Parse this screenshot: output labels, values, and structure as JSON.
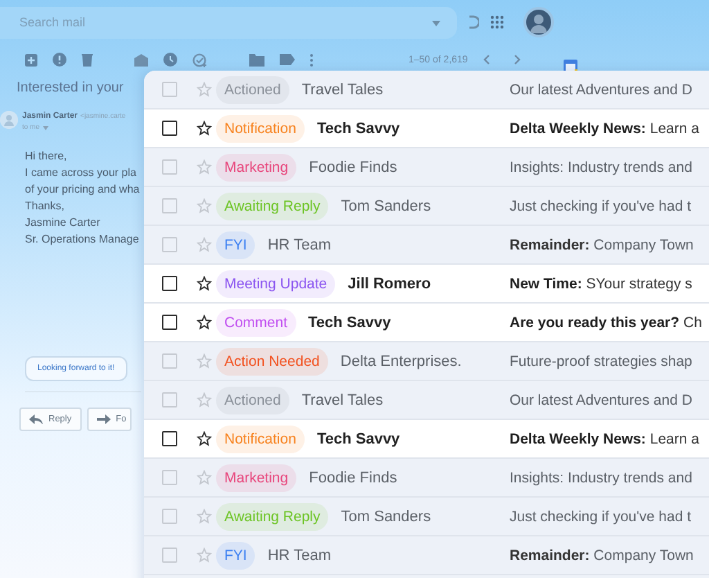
{
  "search": {
    "placeholder": "Search mail"
  },
  "toolbar": {
    "pagination": "1–50 of 2,619"
  },
  "message": {
    "subject": "Interested in your",
    "sender": "Jasmin Carter",
    "address": "<jasmine.carte",
    "recipient": "to me",
    "body": [
      "Hi there,",
      "I came across your pla",
      "of your pricing and wha",
      "Thanks,",
      "Jasmine Carter",
      "Sr. Operations Manage"
    ],
    "smart_reply": "Looking forward to it!",
    "actions": [
      "Reply",
      "Fo"
    ]
  },
  "inbox": {
    "rows": [
      {
        "label": "Actioned",
        "color": "#8a9099",
        "sender": "Travel Tales",
        "subject": "Our latest Adventures and D",
        "unread": false,
        "checked": false,
        "starred": false
      },
      {
        "label": "Notification",
        "color": "#f7821e",
        "sender": "Tech Savvy",
        "subject": "**Delta Weekly News:** Learn a",
        "unread": true,
        "checked": false,
        "starred": false
      },
      {
        "label": "Marketing",
        "color": "#e8467c",
        "sender": "Foodie Finds",
        "subject": "Insights: Industry trends and",
        "unread": false,
        "checked": false,
        "starred": false
      },
      {
        "label": "Awaiting Reply",
        "color": "#6cc424",
        "sender": "Tom Sanders",
        "subject": "Just checking if you've had t",
        "unread": false,
        "checked": false,
        "starred": false
      },
      {
        "label": "FYI",
        "color": "#3b7ff2",
        "sender": "HR Team",
        "subject": "**Remainder:** Company Town",
        "unread": false,
        "checked": false,
        "starred": false
      },
      {
        "label": "Meeting Update",
        "color": "#8b55f0",
        "sender": "Jill Romero",
        "subject": "**New Time:**  SYour strategy s",
        "unread": true,
        "checked": false,
        "starred": false
      },
      {
        "label": "Comment",
        "color": "#c150f0",
        "sender": "Tech Savvy",
        "subject": "**Are you ready this year?** Ch",
        "unread": true,
        "checked": false,
        "starred": false
      },
      {
        "label": "Action Needed",
        "color": "#f2511f",
        "sender": "Delta Enterprises.",
        "subject": "Future-proof strategies shap",
        "unread": false,
        "checked": false,
        "starred": false
      },
      {
        "label": "Actioned",
        "color": "#8a9099",
        "sender": "Travel Tales",
        "subject": "Our latest Adventures and D",
        "unread": false,
        "checked": false,
        "starred": false
      },
      {
        "label": "Notification",
        "color": "#f7821e",
        "sender": "Tech Savvy",
        "subject": "**Delta Weekly News:** Learn a",
        "unread": true,
        "checked": false,
        "starred": false
      },
      {
        "label": "Marketing",
        "color": "#e8467c",
        "sender": "Foodie Finds",
        "subject": "Insights: Industry trends and",
        "unread": false,
        "checked": false,
        "starred": false
      },
      {
        "label": "Awaiting Reply",
        "color": "#6cc424",
        "sender": "Tom Sanders",
        "subject": "Just checking if you've had t",
        "unread": false,
        "checked": false,
        "starred": false
      },
      {
        "label": "FYI",
        "color": "#3b7ff2",
        "sender": "HR Team",
        "subject": "**Remainder:** Company Town",
        "unread": false,
        "checked": false,
        "starred": false
      }
    ]
  }
}
